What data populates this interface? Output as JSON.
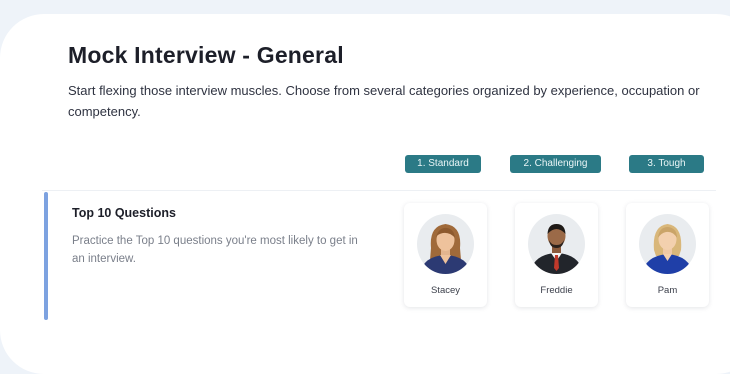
{
  "header": {
    "title": "Mock Interview - General",
    "description": "Start flexing those interview muscles. Choose from several categories organized by experience, occupation or competency."
  },
  "levels": [
    {
      "label": "1. Standard"
    },
    {
      "label": "2. Challenging"
    },
    {
      "label": "3. Tough"
    }
  ],
  "category": {
    "title": "Top 10 Questions",
    "description": "Practice the Top 10 questions you're most likely to get in an interview."
  },
  "interviewers": [
    {
      "name": "Stacey",
      "icon": "woman-avatar-icon"
    },
    {
      "name": "Freddie",
      "icon": "man-avatar-icon"
    },
    {
      "name": "Pam",
      "icon": "woman-avatar-icon"
    }
  ],
  "colors": {
    "level_badge": "#2b7a86",
    "row_accent": "#7da2e0",
    "background": "#eef3f9"
  }
}
